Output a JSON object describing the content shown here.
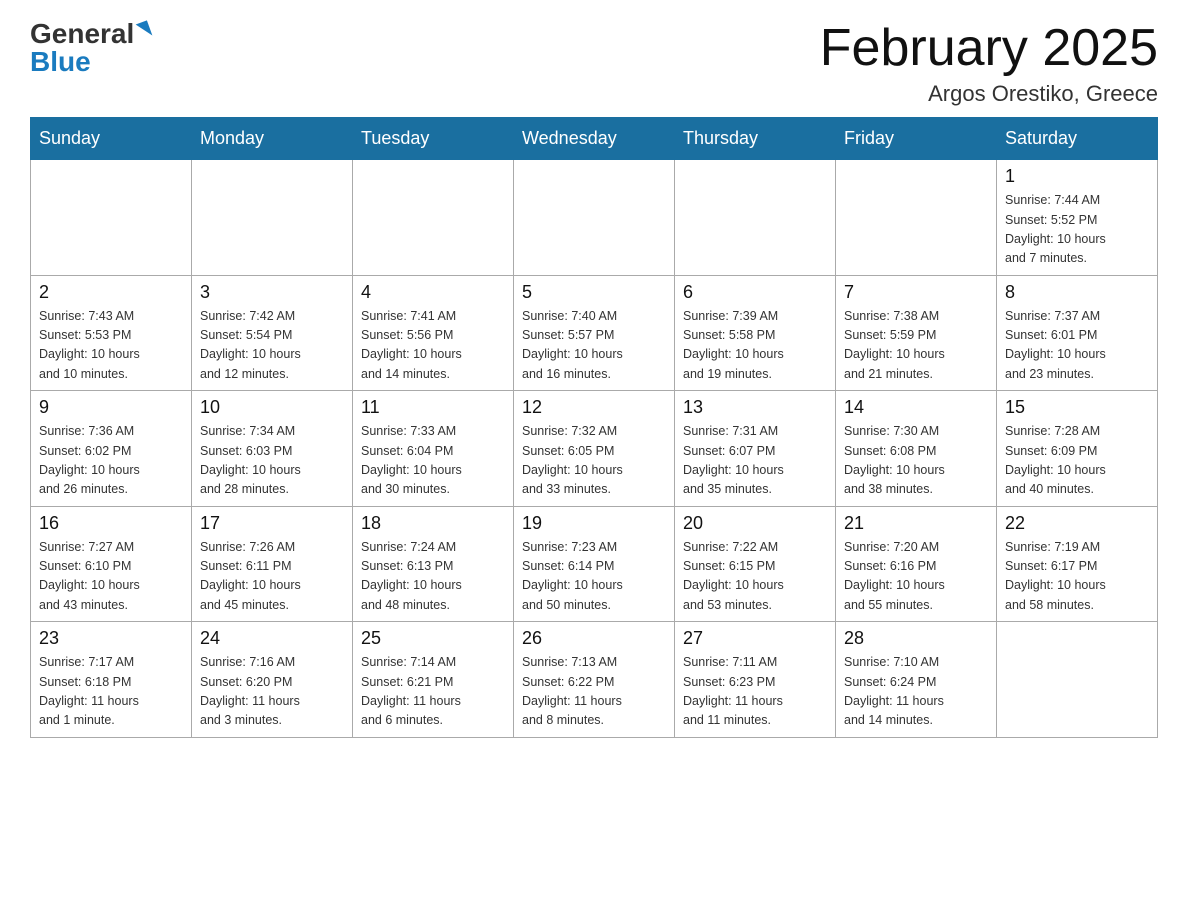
{
  "logo": {
    "general": "General",
    "blue": "Blue"
  },
  "title": "February 2025",
  "location": "Argos Orestiko, Greece",
  "weekdays": [
    "Sunday",
    "Monday",
    "Tuesday",
    "Wednesday",
    "Thursday",
    "Friday",
    "Saturday"
  ],
  "weeks": [
    [
      {
        "day": "",
        "info": ""
      },
      {
        "day": "",
        "info": ""
      },
      {
        "day": "",
        "info": ""
      },
      {
        "day": "",
        "info": ""
      },
      {
        "day": "",
        "info": ""
      },
      {
        "day": "",
        "info": ""
      },
      {
        "day": "1",
        "info": "Sunrise: 7:44 AM\nSunset: 5:52 PM\nDaylight: 10 hours\nand 7 minutes."
      }
    ],
    [
      {
        "day": "2",
        "info": "Sunrise: 7:43 AM\nSunset: 5:53 PM\nDaylight: 10 hours\nand 10 minutes."
      },
      {
        "day": "3",
        "info": "Sunrise: 7:42 AM\nSunset: 5:54 PM\nDaylight: 10 hours\nand 12 minutes."
      },
      {
        "day": "4",
        "info": "Sunrise: 7:41 AM\nSunset: 5:56 PM\nDaylight: 10 hours\nand 14 minutes."
      },
      {
        "day": "5",
        "info": "Sunrise: 7:40 AM\nSunset: 5:57 PM\nDaylight: 10 hours\nand 16 minutes."
      },
      {
        "day": "6",
        "info": "Sunrise: 7:39 AM\nSunset: 5:58 PM\nDaylight: 10 hours\nand 19 minutes."
      },
      {
        "day": "7",
        "info": "Sunrise: 7:38 AM\nSunset: 5:59 PM\nDaylight: 10 hours\nand 21 minutes."
      },
      {
        "day": "8",
        "info": "Sunrise: 7:37 AM\nSunset: 6:01 PM\nDaylight: 10 hours\nand 23 minutes."
      }
    ],
    [
      {
        "day": "9",
        "info": "Sunrise: 7:36 AM\nSunset: 6:02 PM\nDaylight: 10 hours\nand 26 minutes."
      },
      {
        "day": "10",
        "info": "Sunrise: 7:34 AM\nSunset: 6:03 PM\nDaylight: 10 hours\nand 28 minutes."
      },
      {
        "day": "11",
        "info": "Sunrise: 7:33 AM\nSunset: 6:04 PM\nDaylight: 10 hours\nand 30 minutes."
      },
      {
        "day": "12",
        "info": "Sunrise: 7:32 AM\nSunset: 6:05 PM\nDaylight: 10 hours\nand 33 minutes."
      },
      {
        "day": "13",
        "info": "Sunrise: 7:31 AM\nSunset: 6:07 PM\nDaylight: 10 hours\nand 35 minutes."
      },
      {
        "day": "14",
        "info": "Sunrise: 7:30 AM\nSunset: 6:08 PM\nDaylight: 10 hours\nand 38 minutes."
      },
      {
        "day": "15",
        "info": "Sunrise: 7:28 AM\nSunset: 6:09 PM\nDaylight: 10 hours\nand 40 minutes."
      }
    ],
    [
      {
        "day": "16",
        "info": "Sunrise: 7:27 AM\nSunset: 6:10 PM\nDaylight: 10 hours\nand 43 minutes."
      },
      {
        "day": "17",
        "info": "Sunrise: 7:26 AM\nSunset: 6:11 PM\nDaylight: 10 hours\nand 45 minutes."
      },
      {
        "day": "18",
        "info": "Sunrise: 7:24 AM\nSunset: 6:13 PM\nDaylight: 10 hours\nand 48 minutes."
      },
      {
        "day": "19",
        "info": "Sunrise: 7:23 AM\nSunset: 6:14 PM\nDaylight: 10 hours\nand 50 minutes."
      },
      {
        "day": "20",
        "info": "Sunrise: 7:22 AM\nSunset: 6:15 PM\nDaylight: 10 hours\nand 53 minutes."
      },
      {
        "day": "21",
        "info": "Sunrise: 7:20 AM\nSunset: 6:16 PM\nDaylight: 10 hours\nand 55 minutes."
      },
      {
        "day": "22",
        "info": "Sunrise: 7:19 AM\nSunset: 6:17 PM\nDaylight: 10 hours\nand 58 minutes."
      }
    ],
    [
      {
        "day": "23",
        "info": "Sunrise: 7:17 AM\nSunset: 6:18 PM\nDaylight: 11 hours\nand 1 minute."
      },
      {
        "day": "24",
        "info": "Sunrise: 7:16 AM\nSunset: 6:20 PM\nDaylight: 11 hours\nand 3 minutes."
      },
      {
        "day": "25",
        "info": "Sunrise: 7:14 AM\nSunset: 6:21 PM\nDaylight: 11 hours\nand 6 minutes."
      },
      {
        "day": "26",
        "info": "Sunrise: 7:13 AM\nSunset: 6:22 PM\nDaylight: 11 hours\nand 8 minutes."
      },
      {
        "day": "27",
        "info": "Sunrise: 7:11 AM\nSunset: 6:23 PM\nDaylight: 11 hours\nand 11 minutes."
      },
      {
        "day": "28",
        "info": "Sunrise: 7:10 AM\nSunset: 6:24 PM\nDaylight: 11 hours\nand 14 minutes."
      },
      {
        "day": "",
        "info": ""
      }
    ]
  ]
}
